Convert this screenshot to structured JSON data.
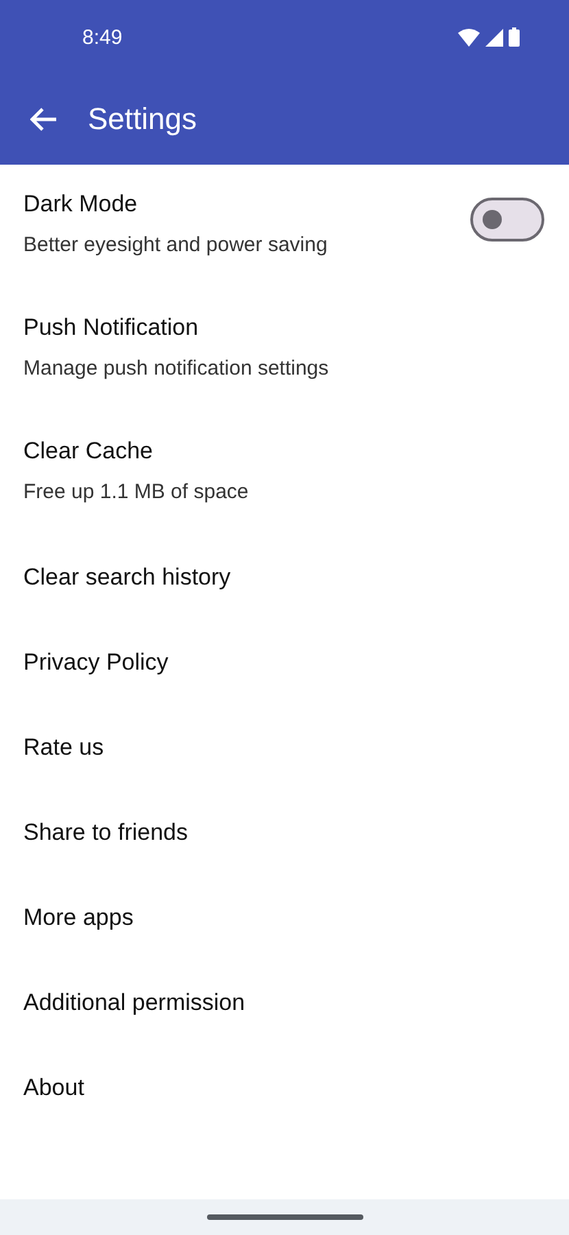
{
  "status_bar": {
    "time": "8:49"
  },
  "app_bar": {
    "title": "Settings"
  },
  "items": [
    {
      "kind": "toggle",
      "title": "Dark Mode",
      "subtitle": "Better eyesight and power saving",
      "on": false
    },
    {
      "kind": "link",
      "title": "Push Notification",
      "subtitle": "Manage push notification settings"
    },
    {
      "kind": "link",
      "title": "Clear Cache",
      "subtitle": "Free up 1.1 MB of space"
    },
    {
      "kind": "link",
      "title": "Clear search history"
    },
    {
      "kind": "link",
      "title": "Privacy Policy"
    },
    {
      "kind": "link",
      "title": "Rate us"
    },
    {
      "kind": "link",
      "title": "Share to friends"
    },
    {
      "kind": "link",
      "title": "More apps"
    },
    {
      "kind": "link",
      "title": "Additional permission"
    },
    {
      "kind": "link",
      "title": "About"
    }
  ]
}
